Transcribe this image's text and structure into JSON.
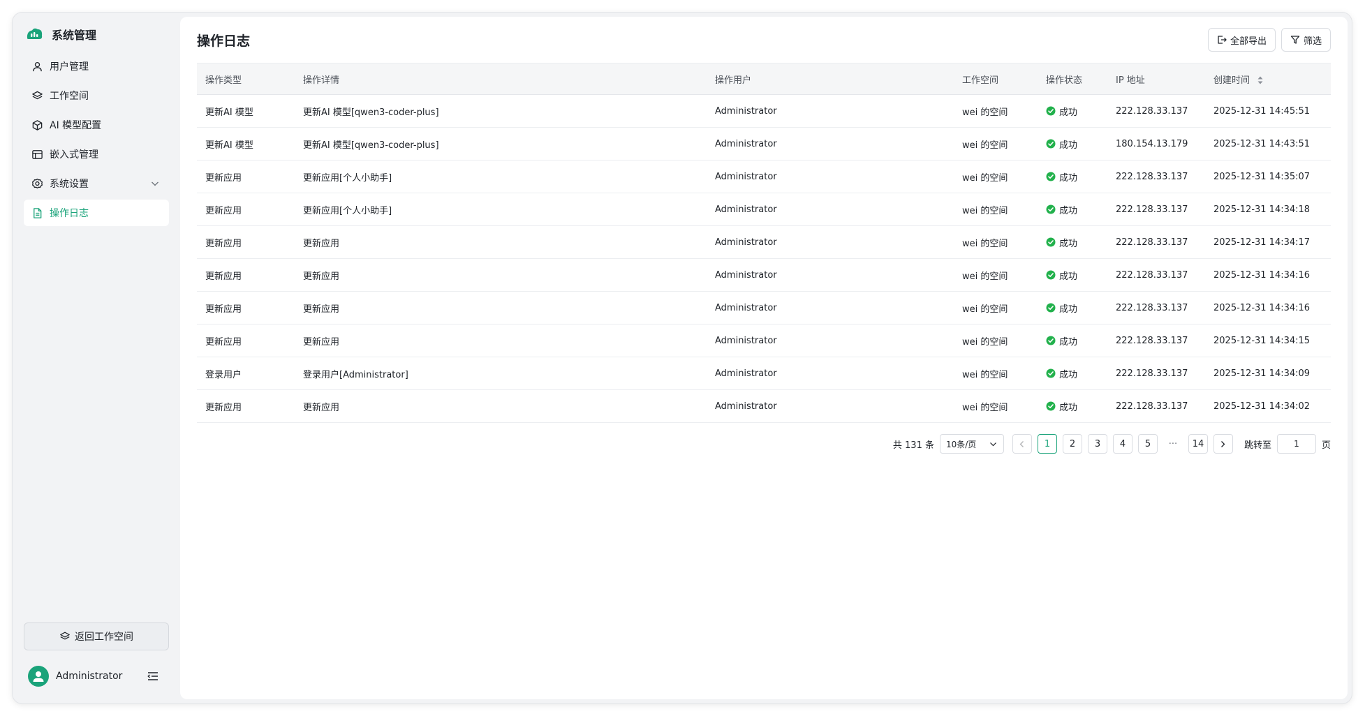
{
  "sidebar": {
    "title": "系统管理",
    "items": [
      {
        "label": "用户管理",
        "icon": "user-icon"
      },
      {
        "label": "工作空间",
        "icon": "layers-icon"
      },
      {
        "label": "AI 模型配置",
        "icon": "cube-icon"
      },
      {
        "label": "嵌入式管理",
        "icon": "embed-icon"
      },
      {
        "label": "系统设置",
        "icon": "gear-icon"
      },
      {
        "label": "操作日志",
        "icon": "document-icon",
        "active": true
      }
    ],
    "back_button": "返回工作空间",
    "user_name": "Administrator"
  },
  "header": {
    "title": "操作日志",
    "export_label": "全部导出",
    "filter_label": "筛选"
  },
  "table": {
    "columns": [
      "操作类型",
      "操作详情",
      "操作用户",
      "工作空间",
      "操作状态",
      "IP 地址",
      "创建时间"
    ],
    "rows": [
      {
        "type": "更新AI 模型",
        "detail": "更新AI 模型[qwen3-coder-plus]",
        "user": "Administrator",
        "workspace": "wei 的空间",
        "status": "成功",
        "ip": "222.128.33.137",
        "time": "2025-12-31 14:45:51"
      },
      {
        "type": "更新AI 模型",
        "detail": "更新AI 模型[qwen3-coder-plus]",
        "user": "Administrator",
        "workspace": "wei 的空间",
        "status": "成功",
        "ip": "180.154.13.179",
        "time": "2025-12-31 14:43:51"
      },
      {
        "type": "更新应用",
        "detail": "更新应用[个人小助手]",
        "user": "Administrator",
        "workspace": "wei 的空间",
        "status": "成功",
        "ip": "222.128.33.137",
        "time": "2025-12-31 14:35:07"
      },
      {
        "type": "更新应用",
        "detail": "更新应用[个人小助手]",
        "user": "Administrator",
        "workspace": "wei 的空间",
        "status": "成功",
        "ip": "222.128.33.137",
        "time": "2025-12-31 14:34:18"
      },
      {
        "type": "更新应用",
        "detail": "更新应用",
        "user": "Administrator",
        "workspace": "wei 的空间",
        "status": "成功",
        "ip": "222.128.33.137",
        "time": "2025-12-31 14:34:17"
      },
      {
        "type": "更新应用",
        "detail": "更新应用",
        "user": "Administrator",
        "workspace": "wei 的空间",
        "status": "成功",
        "ip": "222.128.33.137",
        "time": "2025-12-31 14:34:16"
      },
      {
        "type": "更新应用",
        "detail": "更新应用",
        "user": "Administrator",
        "workspace": "wei 的空间",
        "status": "成功",
        "ip": "222.128.33.137",
        "time": "2025-12-31 14:34:16"
      },
      {
        "type": "更新应用",
        "detail": "更新应用",
        "user": "Administrator",
        "workspace": "wei 的空间",
        "status": "成功",
        "ip": "222.128.33.137",
        "time": "2025-12-31 14:34:15"
      },
      {
        "type": "登录用户",
        "detail": "登录用户[Administrator]",
        "user": "Administrator",
        "workspace": "wei 的空间",
        "status": "成功",
        "ip": "222.128.33.137",
        "time": "2025-12-31 14:34:09"
      },
      {
        "type": "更新应用",
        "detail": "更新应用",
        "user": "Administrator",
        "workspace": "wei 的空间",
        "status": "成功",
        "ip": "222.128.33.137",
        "time": "2025-12-31 14:34:02"
      }
    ]
  },
  "pagination": {
    "total_label": "共 131 条",
    "page_size": "10条/页",
    "pages": [
      "1",
      "2",
      "3",
      "4",
      "5"
    ],
    "ellipsis": "···",
    "last_page": "14",
    "current_page": "1",
    "jump_label": "跳转至",
    "jump_value": "1",
    "page_suffix": "页"
  },
  "colors": {
    "accent": "#1aa37a",
    "success": "#22b14c",
    "sidebar_bg": "#f2f3f5"
  }
}
